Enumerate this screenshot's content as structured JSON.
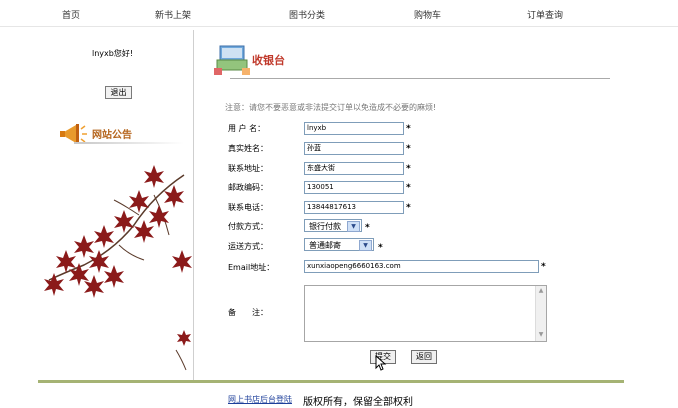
{
  "nav": {
    "items": [
      "首页",
      "新书上架",
      "图书分类",
      "购物车",
      "订单查询"
    ]
  },
  "sidebar": {
    "greeting": "lnyxb您好!",
    "logout_label": "退出",
    "notice_title": "网站公告"
  },
  "main": {
    "title": "收银台",
    "warning": "注意：请您不要恶意或非法提交订单以免造成不必要的麻烦!",
    "required_mark": "*",
    "fields": {
      "username": {
        "label": "用 户 名：",
        "value": "lnyxb"
      },
      "realname": {
        "label": "真实姓名：",
        "value": "孙蓝"
      },
      "address": {
        "label": "联系地址：",
        "value": "东盛大街"
      },
      "postcode": {
        "label": "邮政编码：",
        "value": "130051"
      },
      "phone": {
        "label": "联系电话：",
        "value": "13844817613"
      },
      "payment": {
        "label": "付款方式：",
        "value": "银行付款"
      },
      "shipping": {
        "label": "运送方式：",
        "value": "普通邮寄"
      },
      "email": {
        "label": "Email地址：",
        "value": "xunxiaopeng6660163.com"
      },
      "remark": {
        "label": "备　　注：",
        "value": ""
      }
    },
    "submit_label": "提交",
    "back_label": "返回"
  },
  "footer": {
    "admin_link": "网上书店后台登陆",
    "copyright": "版权所有，保留全部权利"
  },
  "colors": {
    "accent_red": "#c0392b",
    "maple": "#8b1a1a",
    "footer_bar": "#a5b374",
    "link_blue": "#1d3f9a"
  }
}
